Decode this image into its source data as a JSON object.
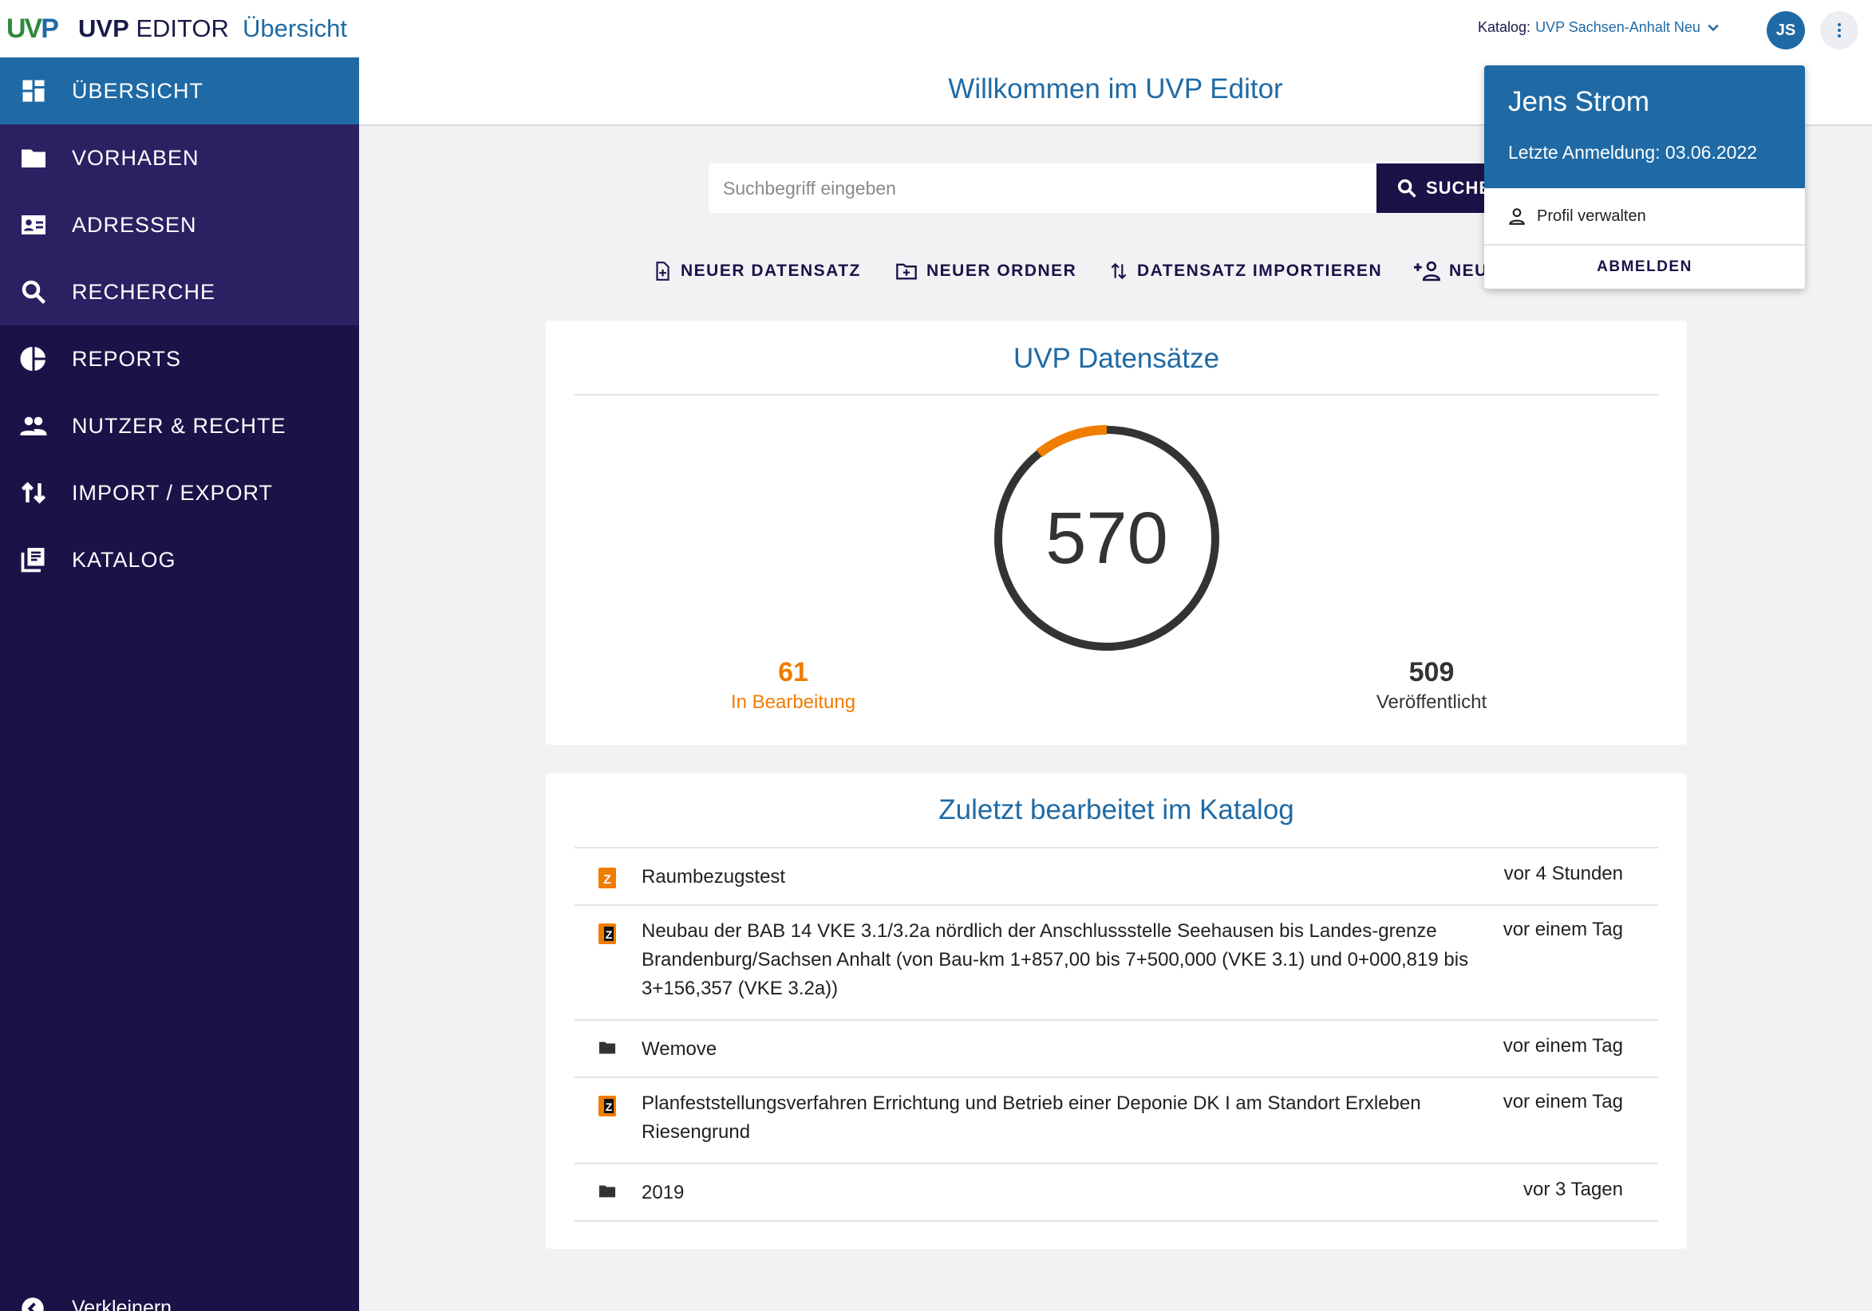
{
  "header": {
    "logo_part1": "UV",
    "logo_part2": "P",
    "app_name_bold": "UVP",
    "app_name_rest": " EDITOR",
    "breadcrumb": "Übersicht",
    "catalog_label": "Katalog:",
    "catalog_name": "UVP Sachsen-Anhalt Neu",
    "avatar_initials": "JS"
  },
  "sidebar": {
    "items": [
      {
        "label": "ÜBERSICHT",
        "icon": "dashboard-icon",
        "state": "active"
      },
      {
        "label": "VORHABEN",
        "icon": "folder-icon",
        "state": "hover"
      },
      {
        "label": "ADRESSEN",
        "icon": "contact-card-icon",
        "state": "hover"
      },
      {
        "label": "RECHERCHE",
        "icon": "search-icon",
        "state": "hover"
      },
      {
        "label": "REPORTS",
        "icon": "pie-chart-icon",
        "state": "normal"
      },
      {
        "label": "NUTZER & RECHTE",
        "icon": "people-icon",
        "state": "normal"
      },
      {
        "label": "IMPORT / EXPORT",
        "icon": "import-export-icon",
        "state": "normal"
      },
      {
        "label": "KATALOG",
        "icon": "catalog-icon",
        "state": "normal"
      }
    ],
    "collapse_label": "Verkleinern"
  },
  "main": {
    "welcome": "Willkommen im UVP Editor",
    "search_placeholder": "Suchbegriff eingeben",
    "search_button": "SUCHE",
    "actions": [
      {
        "label": "NEUER DATENSATZ",
        "icon": "new-document-icon"
      },
      {
        "label": "NEUER ORDNER",
        "icon": "new-folder-icon"
      },
      {
        "label": "DATENSATZ IMPORTIEREN",
        "icon": "import-arrows-icon"
      },
      {
        "label": "NEU",
        "icon": "add-person-icon"
      }
    ]
  },
  "stats_card": {
    "title": "UVP Datensätze",
    "total": "570",
    "in_progress_count": "61",
    "in_progress_label": "In Bearbeitung",
    "published_count": "509",
    "published_label": "Veröffentlicht",
    "in_progress_fraction": 0.107,
    "colors": {
      "in_progress": "#f07c00",
      "published": "#333333"
    }
  },
  "recent_card": {
    "title": "Zuletzt bearbeitet im Katalog",
    "rows": [
      {
        "type": "document-icon",
        "title": "Raumbezugstest",
        "time": "vor 4 Stunden"
      },
      {
        "type": "document-icon",
        "title": "Neubau der BAB 14 VKE 3.1/3.2a nördlich der Anschlussstelle Seehausen bis Landes-grenze Brandenburg/Sachsen Anhalt (von Bau-km 1+857,00 bis 7+500,000 (VKE 3.1) und 0+000,819 bis 3+156,357 (VKE 3.2a))",
        "time": "vor einem Tag"
      },
      {
        "type": "folder-icon",
        "title": "Wemove",
        "time": "vor einem Tag"
      },
      {
        "type": "document-icon",
        "title": "Planfeststellungsverfahren Errichtung und Betrieb einer Deponie DK I am Standort Erxleben Riesengrund",
        "time": "vor einem Tag"
      },
      {
        "type": "folder-icon",
        "title": "2019",
        "time": "vor 3 Tagen"
      }
    ]
  },
  "user_popup": {
    "name": "Jens Strom",
    "last_login": "Letzte Anmeldung: 03.06.2022",
    "profile_label": "Profil verwalten",
    "logout_label": "ABMELDEN"
  },
  "colors": {
    "primary": "#1f6aa5",
    "sidebar": "#1b1248",
    "accent_orange": "#f07c00"
  }
}
